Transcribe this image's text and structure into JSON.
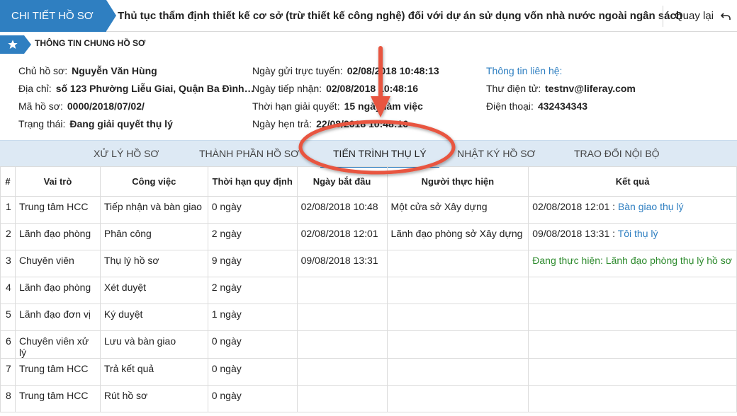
{
  "header": {
    "breadcrumb": "CHI TIẾT HỒ SƠ",
    "title": "Thủ tục thẩm định thiết kế cơ sở (trừ thiết kế công nghệ) đối với dự án sử dụng vốn nhà nước ngoài ngân sách",
    "back_label": "Quay lại"
  },
  "section": {
    "title": "THÔNG TIN CHUNG HỒ SƠ"
  },
  "info": {
    "owner_label": "Chủ hồ sơ:",
    "owner": "Nguyễn Văn Hùng",
    "address_label": "Địa chỉ:",
    "address": "số 123 Phường Liễu Giai, Quận Ba Đình…",
    "code_label": "Mã hồ sơ:",
    "code": "0000/2018/07/02/",
    "status_label": "Trạng thái:",
    "status": "Đang giải quyết thụ lý",
    "sent_label": "Ngày gửi trực tuyến:",
    "sent": "02/08/2018 10:48:13",
    "received_label": "Ngày tiếp nhận:",
    "received": "02/08/2018 10:48:16",
    "deadline_label": "Thời hạn giải quyết:",
    "deadline": "15 ngày làm việc",
    "appointment_label": "Ngày hẹn trả:",
    "appointment": "22/08/2018 10:48:16",
    "contact_label": "Thông tin liên hệ:",
    "email_label": "Thư điện tử:",
    "email": "testnv@liferay.com",
    "phone_label": "Điện thoại:",
    "phone": "432434343"
  },
  "tabs": [
    "XỬ LÝ HỒ SƠ",
    "THÀNH PHẦN HỒ SƠ",
    "TIẾN TRÌNH THỤ LÝ",
    "NHẬT KÝ HỒ SƠ",
    "TRAO ĐỔI NỘI BỘ"
  ],
  "active_tab": "TIẾN TRÌNH THỤ LÝ",
  "table": {
    "headers": [
      "#",
      "Vai trò",
      "Công việc",
      "Thời hạn quy định",
      "Ngày bắt đầu",
      "Người thực hiện",
      "Kết quả"
    ],
    "rows": [
      {
        "n": "1",
        "role": "Trung tâm HCC",
        "task": "Tiếp nhận và bàn giao",
        "limit": "0 ngày",
        "start": "02/08/2018 10:48",
        "actor": "Một cửa sở Xây dựng",
        "result_time": "02/08/2018 12:01 :",
        "result_link": "Bàn giao thụ lý",
        "result_status": ""
      },
      {
        "n": "2",
        "role": "Lãnh đạo phòng",
        "task": "Phân công",
        "limit": "2 ngày",
        "start": "02/08/2018 12:01",
        "actor": "Lãnh đạo phòng sở Xây dựng",
        "result_time": "09/08/2018 13:31 :",
        "result_link": "Tôi thụ lý",
        "result_status": ""
      },
      {
        "n": "3",
        "role": "Chuyên viên",
        "task": "Thụ lý hồ sơ",
        "limit": "9 ngày",
        "start": "09/08/2018 13:31",
        "actor": "",
        "result_time": "",
        "result_link": "",
        "result_status": "Đang thực hiện: Lãnh đạo phòng thụ lý hồ sơ"
      },
      {
        "n": "4",
        "role": "Lãnh đạo phòng",
        "task": "Xét duyệt",
        "limit": "2 ngày",
        "start": "",
        "actor": "",
        "result_time": "",
        "result_link": "",
        "result_status": ""
      },
      {
        "n": "5",
        "role": "Lãnh đạo đơn vị",
        "task": "Ký duyệt",
        "limit": "1 ngày",
        "start": "",
        "actor": "",
        "result_time": "",
        "result_link": "",
        "result_status": ""
      },
      {
        "n": "6",
        "role": "Chuyên viên xử lý",
        "task": "Lưu và bàn giao",
        "limit": "0 ngày",
        "start": "",
        "actor": "",
        "result_time": "",
        "result_link": "",
        "result_status": ""
      },
      {
        "n": "7",
        "role": "Trung tâm HCC",
        "task": "Trả kết quả",
        "limit": "0 ngày",
        "start": "",
        "actor": "",
        "result_time": "",
        "result_link": "",
        "result_status": ""
      },
      {
        "n": "8",
        "role": "Trung tâm HCC",
        "task": "Rút hồ sơ",
        "limit": "0 ngày",
        "start": "",
        "actor": "",
        "result_time": "",
        "result_link": "",
        "result_status": ""
      }
    ]
  },
  "colors": {
    "accent": "#2f7fc1",
    "tab_bg": "#dde9f4",
    "status_green": "#2e8b2e",
    "annotation": "#e8553f"
  },
  "icons": {
    "back": "undo-icon",
    "section": "star-icon"
  }
}
